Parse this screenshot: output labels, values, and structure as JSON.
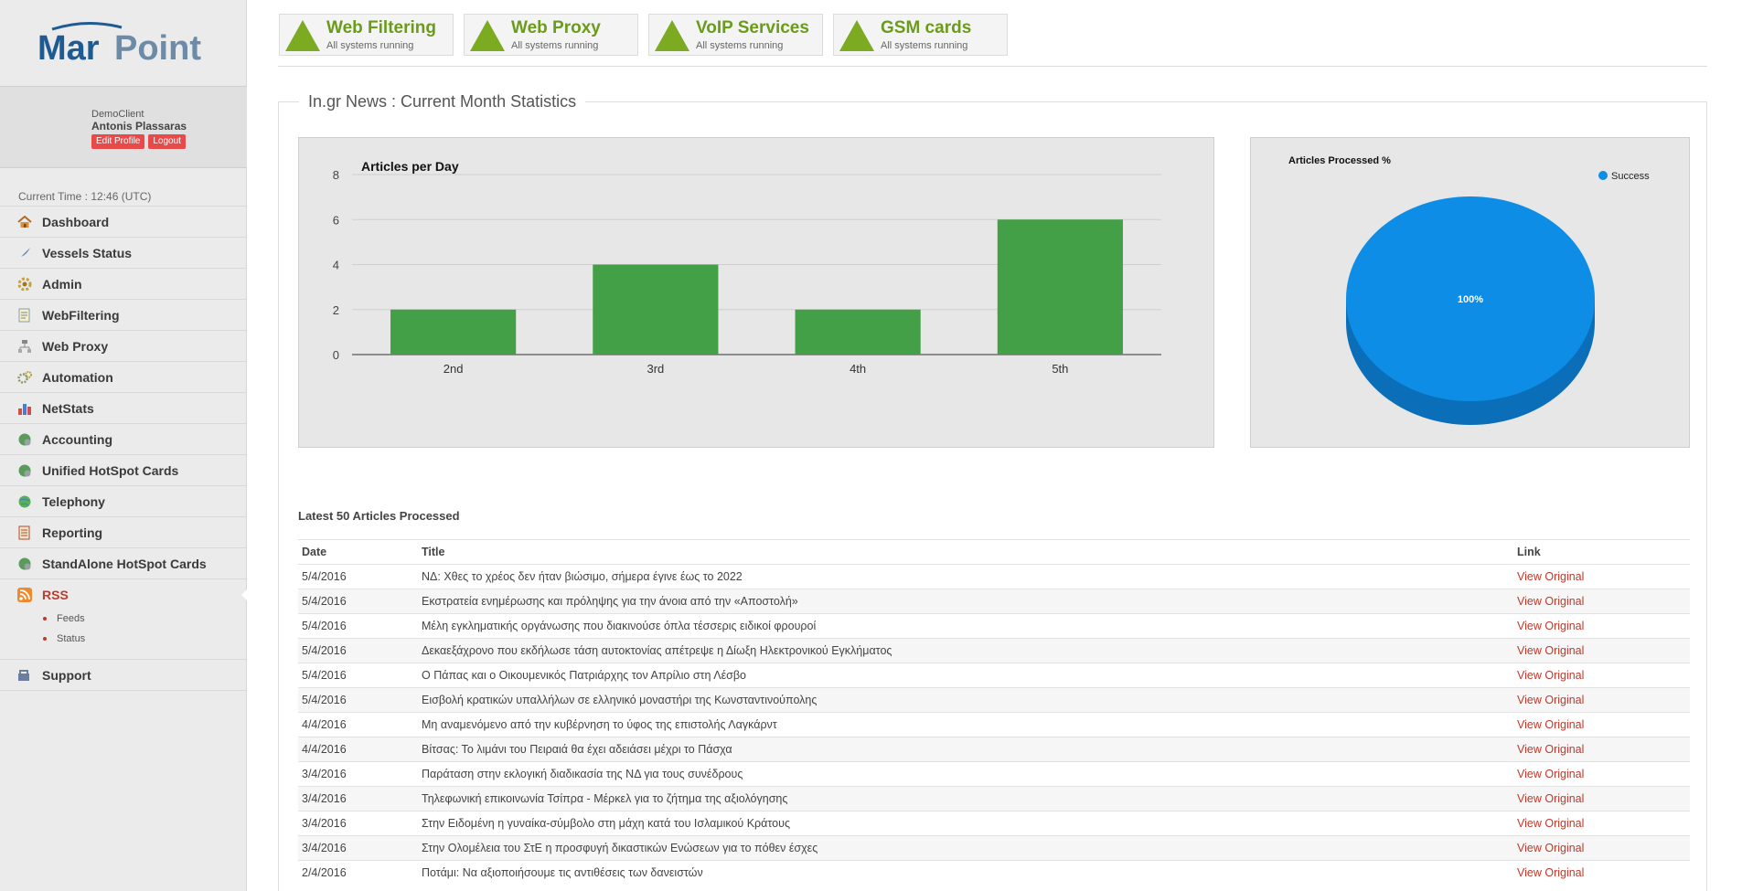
{
  "brand": {
    "logo_text": "MarPoint",
    "colors": {
      "logo_mar": "#1e5b93",
      "logo_point": "#6d8aa6",
      "accent_red": "#c0392b",
      "status_green": "#7cab22",
      "bar_green": "#43a047",
      "pie_blue": "#0e8de6",
      "pie_blue_dark": "#0a6fb8"
    }
  },
  "user": {
    "client": "DemoClient",
    "name": "Antonis Plassaras",
    "edit_label": "Edit Profile",
    "logout_label": "Logout"
  },
  "clock": "Current Time : 12:46 (UTC)",
  "menu": [
    {
      "label": "Dashboard",
      "icon": "home-icon"
    },
    {
      "label": "Vessels Status",
      "icon": "feather-icon"
    },
    {
      "label": "Admin",
      "icon": "gear-icon"
    },
    {
      "label": "WebFiltering",
      "icon": "document-icon"
    },
    {
      "label": "Web Proxy",
      "icon": "network-icon"
    },
    {
      "label": "Automation",
      "icon": "cogs-icon"
    },
    {
      "label": "NetStats",
      "icon": "bar-chart-icon"
    },
    {
      "label": "Accounting",
      "icon": "globe-gear-icon"
    },
    {
      "label": "Unified HotSpot Cards",
      "icon": "globe-gear-icon"
    },
    {
      "label": "Telephony",
      "icon": "globe-icon"
    },
    {
      "label": "Reporting",
      "icon": "report-icon"
    },
    {
      "label": "StandAlone HotSpot Cards",
      "icon": "globe-gear-icon"
    },
    {
      "label": "RSS",
      "icon": "rss-icon",
      "active": true
    }
  ],
  "submenu": [
    "Feeds",
    "Status"
  ],
  "support_label": "Support",
  "tiles": [
    {
      "name": "Web Filtering",
      "status": "All systems running"
    },
    {
      "name": "Web Proxy",
      "status": "All systems running"
    },
    {
      "name": "VoIP Services",
      "status": "All systems running"
    },
    {
      "name": "GSM cards",
      "status": "All systems running"
    }
  ],
  "panel_title": "In.gr News : Current Month Statistics",
  "chart_data": [
    {
      "type": "bar",
      "title": "Articles per Day",
      "categories": [
        "2nd",
        "3rd",
        "4th",
        "5th"
      ],
      "values": [
        2,
        4,
        2,
        6
      ],
      "ylim": [
        0,
        8
      ],
      "yticks": [
        0,
        2,
        4,
        6,
        8
      ],
      "xlabel": "",
      "ylabel": "",
      "grid": true
    },
    {
      "type": "pie",
      "title": "Articles Processed %",
      "labels": [
        "Success"
      ],
      "values": [
        100
      ],
      "slice_labels": [
        "100%"
      ],
      "legend": "top-right"
    }
  ],
  "table": {
    "title": "Latest 50 Articles Processed",
    "headers": {
      "date": "Date",
      "title": "Title",
      "link": "Link"
    },
    "link_label": "View Original",
    "rows": [
      {
        "date": "5/4/2016",
        "title": "ΝΔ: Χθες το χρέος δεν ήταν βιώσιμο, σήμερα έγινε έως το 2022"
      },
      {
        "date": "5/4/2016",
        "title": "Εκστρατεία ενημέρωσης και πρόληψης για την άνοια από την «Αποστολή»"
      },
      {
        "date": "5/4/2016",
        "title": "Μέλη εγκληματικής οργάνωσης που διακινούσε όπλα τέσσερις ειδικοί φρουροί"
      },
      {
        "date": "5/4/2016",
        "title": "Δεκαεξάχρονο που εκδήλωσε τάση αυτοκτονίας απέτρεψε η Δίωξη Ηλεκτρονικού Εγκλήματος"
      },
      {
        "date": "5/4/2016",
        "title": "Ο Πάπας και ο Οικουμενικός Πατριάρχης τον Απρίλιο στη Λέσβο"
      },
      {
        "date": "5/4/2016",
        "title": "Εισβολή κρατικών υπαλλήλων σε ελληνικό μοναστήρι της Κωνσταντινούπολης"
      },
      {
        "date": "4/4/2016",
        "title": "Μη αναμενόμενο από την κυβέρνηση το ύφος της επιστολής Λαγκάρντ"
      },
      {
        "date": "4/4/2016",
        "title": "Βίτσας: Το λιμάνι του Πειραιά θα έχει αδειάσει μέχρι το Πάσχα"
      },
      {
        "date": "3/4/2016",
        "title": "Παράταση στην εκλογική διαδικασία της ΝΔ για τους συνέδρους"
      },
      {
        "date": "3/4/2016",
        "title": "Τηλεφωνική επικοινωνία Τσίπρα - Μέρκελ για το ζήτημα της αξιολόγησης"
      },
      {
        "date": "3/4/2016",
        "title": "Στην Ειδομένη η γυναίκα-σύμβολο στη μάχη κατά του Ισλαμικού Κράτους"
      },
      {
        "date": "3/4/2016",
        "title": "Στην Ολομέλεια του ΣτΕ η προσφυγή δικαστικών Ενώσεων για το πόθεν έσχες"
      },
      {
        "date": "2/4/2016",
        "title": "Ποτάμι: Να αξιοποιήσουμε τις αντιθέσεις των δανειστών"
      }
    ]
  }
}
